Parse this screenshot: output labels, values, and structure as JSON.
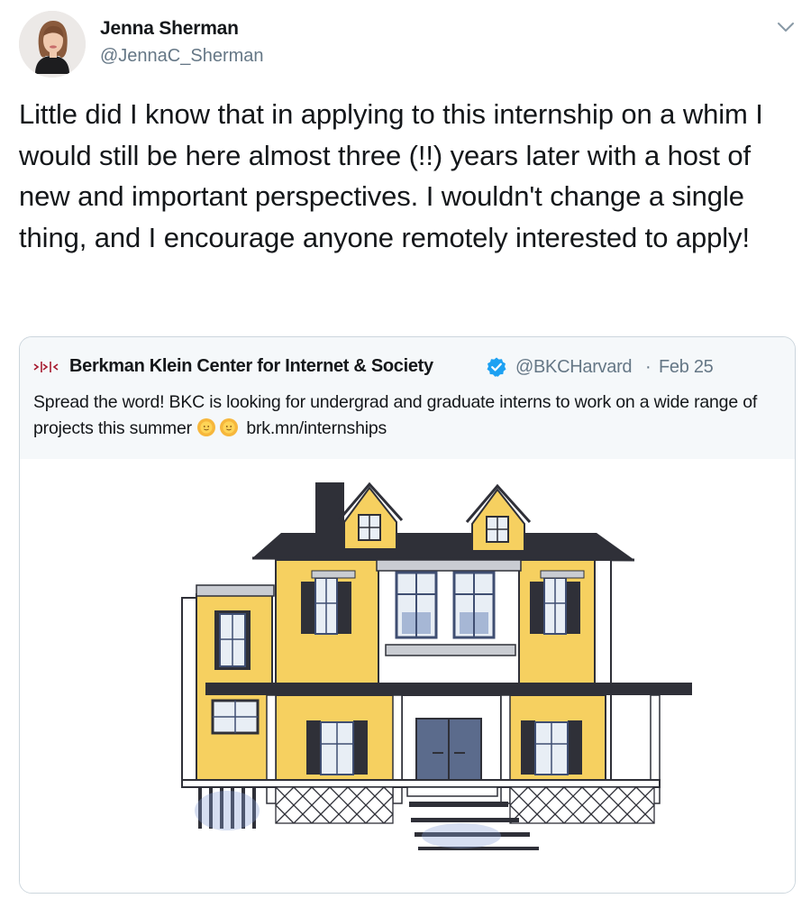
{
  "author": {
    "name": "Jenna Sherman",
    "handle": "@JennaC_Sherman"
  },
  "tweet": {
    "text": "Little did I know that in applying to this internship on a whim I would still be here almost three (!!) years later with a host of new and important perspectives. I wouldn't change a single thing, and I encourage anyone remotely interested to apply!"
  },
  "quote": {
    "logo_text": "›|›|‹",
    "name": "Berkman Klein Center for Internet & Society",
    "handle": "@BKCHarvard",
    "separator": "·",
    "date": "Feb 25",
    "text_before_emoji": "Spread the word! BKC is looking for undergrad and graduate interns to work on a wide range of projects this summer",
    "link": "brk.mn/internships",
    "image_subject": "illustration of yellow house"
  },
  "icons": {
    "caret": "chevron-down-icon",
    "verified": "verified-badge-icon",
    "emoji": "sun-with-face-emoji"
  },
  "colors": {
    "text": "#14171a",
    "secondary": "#657786",
    "verified": "#1da1f2",
    "card_border": "#ccd6dd",
    "card_header_bg": "#f5f8fa",
    "house_yellow": "#f6d060",
    "roof": "#2f3038",
    "trim_blue": "#3f4e72"
  }
}
